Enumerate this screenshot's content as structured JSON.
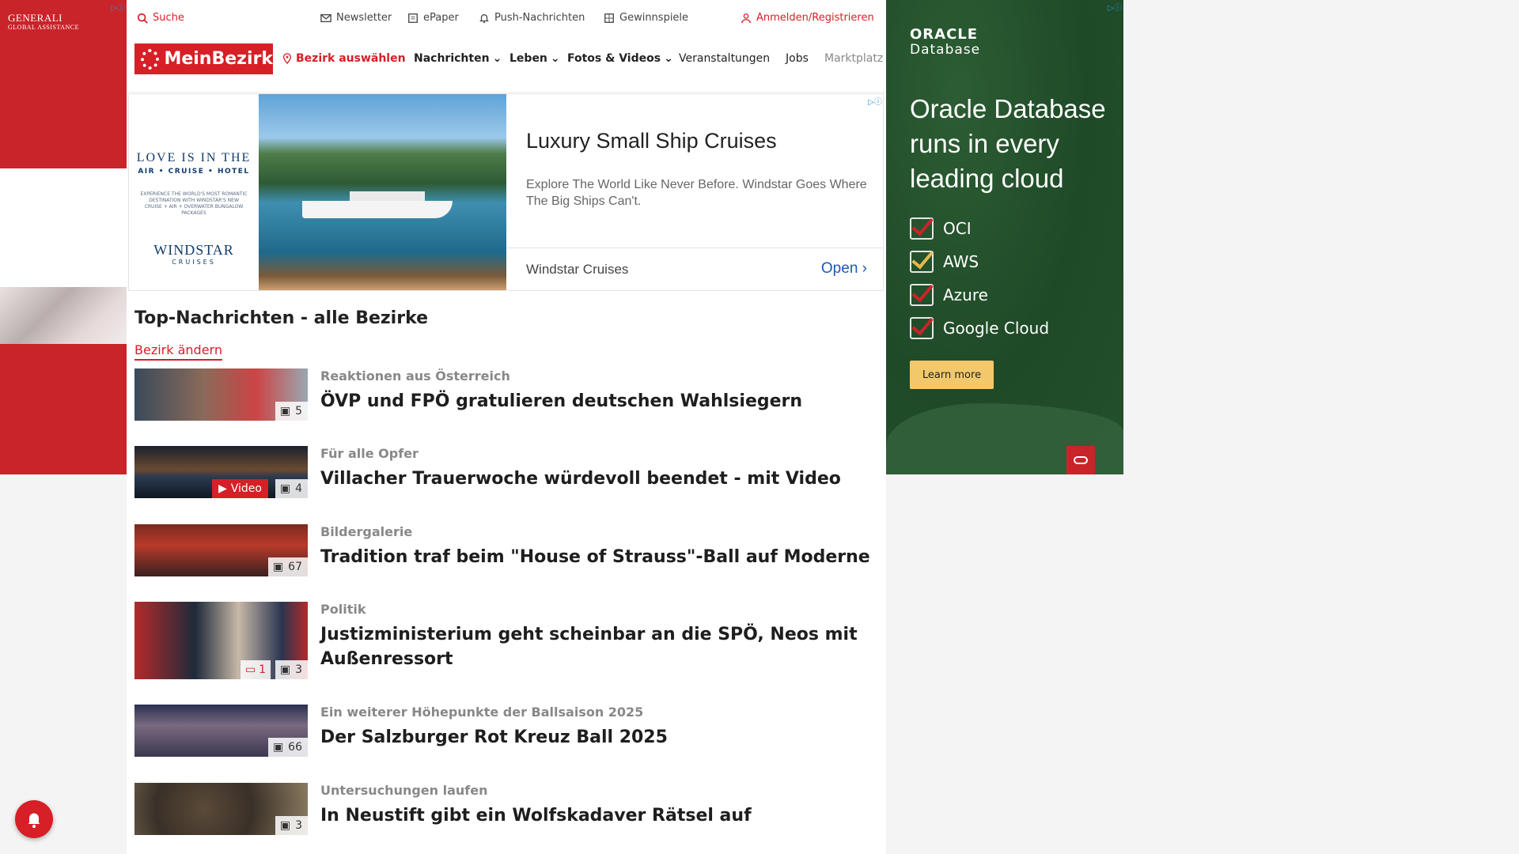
{
  "left_ad": {
    "brand_line1": "GENERALI",
    "brand_line2": "GLOBAL ASSISTANCE",
    "colors": {
      "background": "#c9242a"
    }
  },
  "topbar": {
    "search": "Suche",
    "newsletter": "Newsletter",
    "epaper": "ePaper",
    "push": "Push-Nachrichten",
    "contests": "Gewinnspiele",
    "login": "Anmelden/Registrieren"
  },
  "nav": {
    "brand": "MeinBezirk",
    "district": "Bezirk auswählen",
    "items": [
      "Nachrichten",
      "Leben",
      "Fotos & Videos",
      "Veranstaltungen",
      "Jobs",
      "Marktplatz"
    ],
    "brand_color": "#d61f26"
  },
  "content_ad": {
    "panel_line1": "LOVE IS IN THE",
    "panel_line2": "AIR • CRUISE • HOTEL",
    "panel_small": "EXPERIENCE THE WORLD'S MOST ROMANTIC DESTINATION WITH WINDSTAR'S NEW CRUISE + AIR + OVERWATER BUNGALOW PACKAGES",
    "panel_brand": "WINDSTAR",
    "panel_brand_sub": "CRUISES",
    "headline": "Luxury Small Ship Cruises",
    "description": "Explore The World Like Never Before. Windstar Goes Where The Big Ships Can't.",
    "advertiser": "Windstar Cruises",
    "cta": "Open"
  },
  "news": {
    "section_title": "Top-Nachrichten - alle Bezirke",
    "change_district": "Bezirk ändern",
    "articles": [
      {
        "kicker": "Reaktionen aus Österreich",
        "title": "ÖVP und FPÖ gratulieren deutschen Wahlsiegern",
        "images": "5",
        "thumb_icon": "gallery-icon"
      },
      {
        "kicker": "Für alle Opfer",
        "title": "Villacher Trauerwoche würdevoll beendet - mit Video",
        "images": "4",
        "video": "Video"
      },
      {
        "kicker": "Bildergalerie",
        "title": "Tradition traf beim \"House of Strauss\"-Ball auf Moderne",
        "images": "67"
      },
      {
        "kicker": "Politik",
        "title": "Justizministerium geht scheinbar an die SPÖ, Neos mit Außenressort",
        "images": "3",
        "comments": "1"
      },
      {
        "kicker": "Ein weiterer Höhepunkte der Ballsaison 2025",
        "title": "Der Salzburger Rot Kreuz Ball 2025",
        "images": "66"
      },
      {
        "kicker": "Untersuchungen laufen",
        "title": "In Neustift gibt ein Wolfskadaver Rätsel auf",
        "images": "3"
      }
    ]
  },
  "right_ad": {
    "brand_line1": "ORACLE",
    "brand_line2": "Database",
    "headline": "Oracle Database runs in every leading cloud",
    "clouds": [
      "OCI",
      "AWS",
      "Azure",
      "Google Cloud"
    ],
    "cta": "Learn more"
  }
}
